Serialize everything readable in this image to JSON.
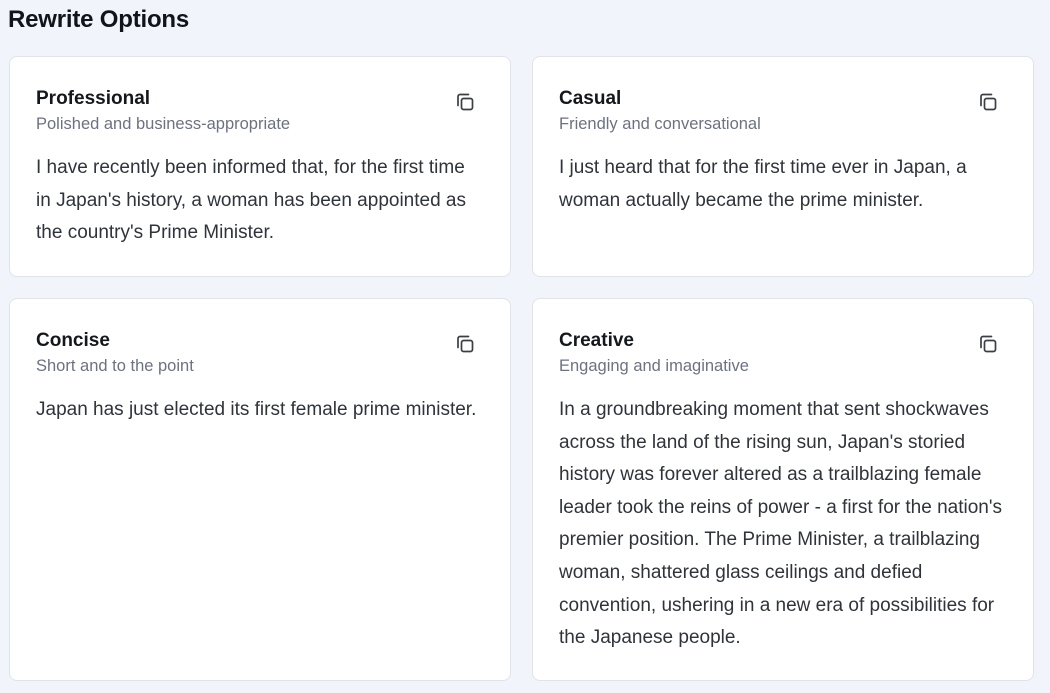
{
  "page": {
    "heading": "Rewrite Options"
  },
  "options": [
    {
      "title": "Professional",
      "subtitle": "Polished and business-appropriate",
      "text": "I have recently been informed that, for the first time in Japan's history, a woman has been appointed as the country's Prime Minister.",
      "copy_icon": "copy-icon"
    },
    {
      "title": "Casual",
      "subtitle": "Friendly and conversational",
      "text": "I just heard that for the first time ever in Japan, a woman actually became the prime minister.",
      "copy_icon": "copy-icon"
    },
    {
      "title": "Concise",
      "subtitle": "Short and to the point",
      "text": "Japan has just elected its first female prime minister.",
      "copy_icon": "copy-icon"
    },
    {
      "title": "Creative",
      "subtitle": "Engaging and imaginative",
      "text": "In a groundbreaking moment that sent shockwaves across the land of the rising sun, Japan's storied history was forever altered as a trailblazing female leader took the reins of power - a first for the nation's premier position. The Prime Minister, a trailblazing woman, shattered glass ceilings and defied convention, ushering in a new era of possibilities for the Japanese people.",
      "copy_icon": "copy-icon"
    }
  ],
  "colors": {
    "background": "#f1f5fb",
    "card_background": "#ffffff",
    "card_border": "#dfe3ea",
    "subtitle": "#6b7280",
    "body_text": "#2f343b",
    "icon": "#3a3f46"
  }
}
